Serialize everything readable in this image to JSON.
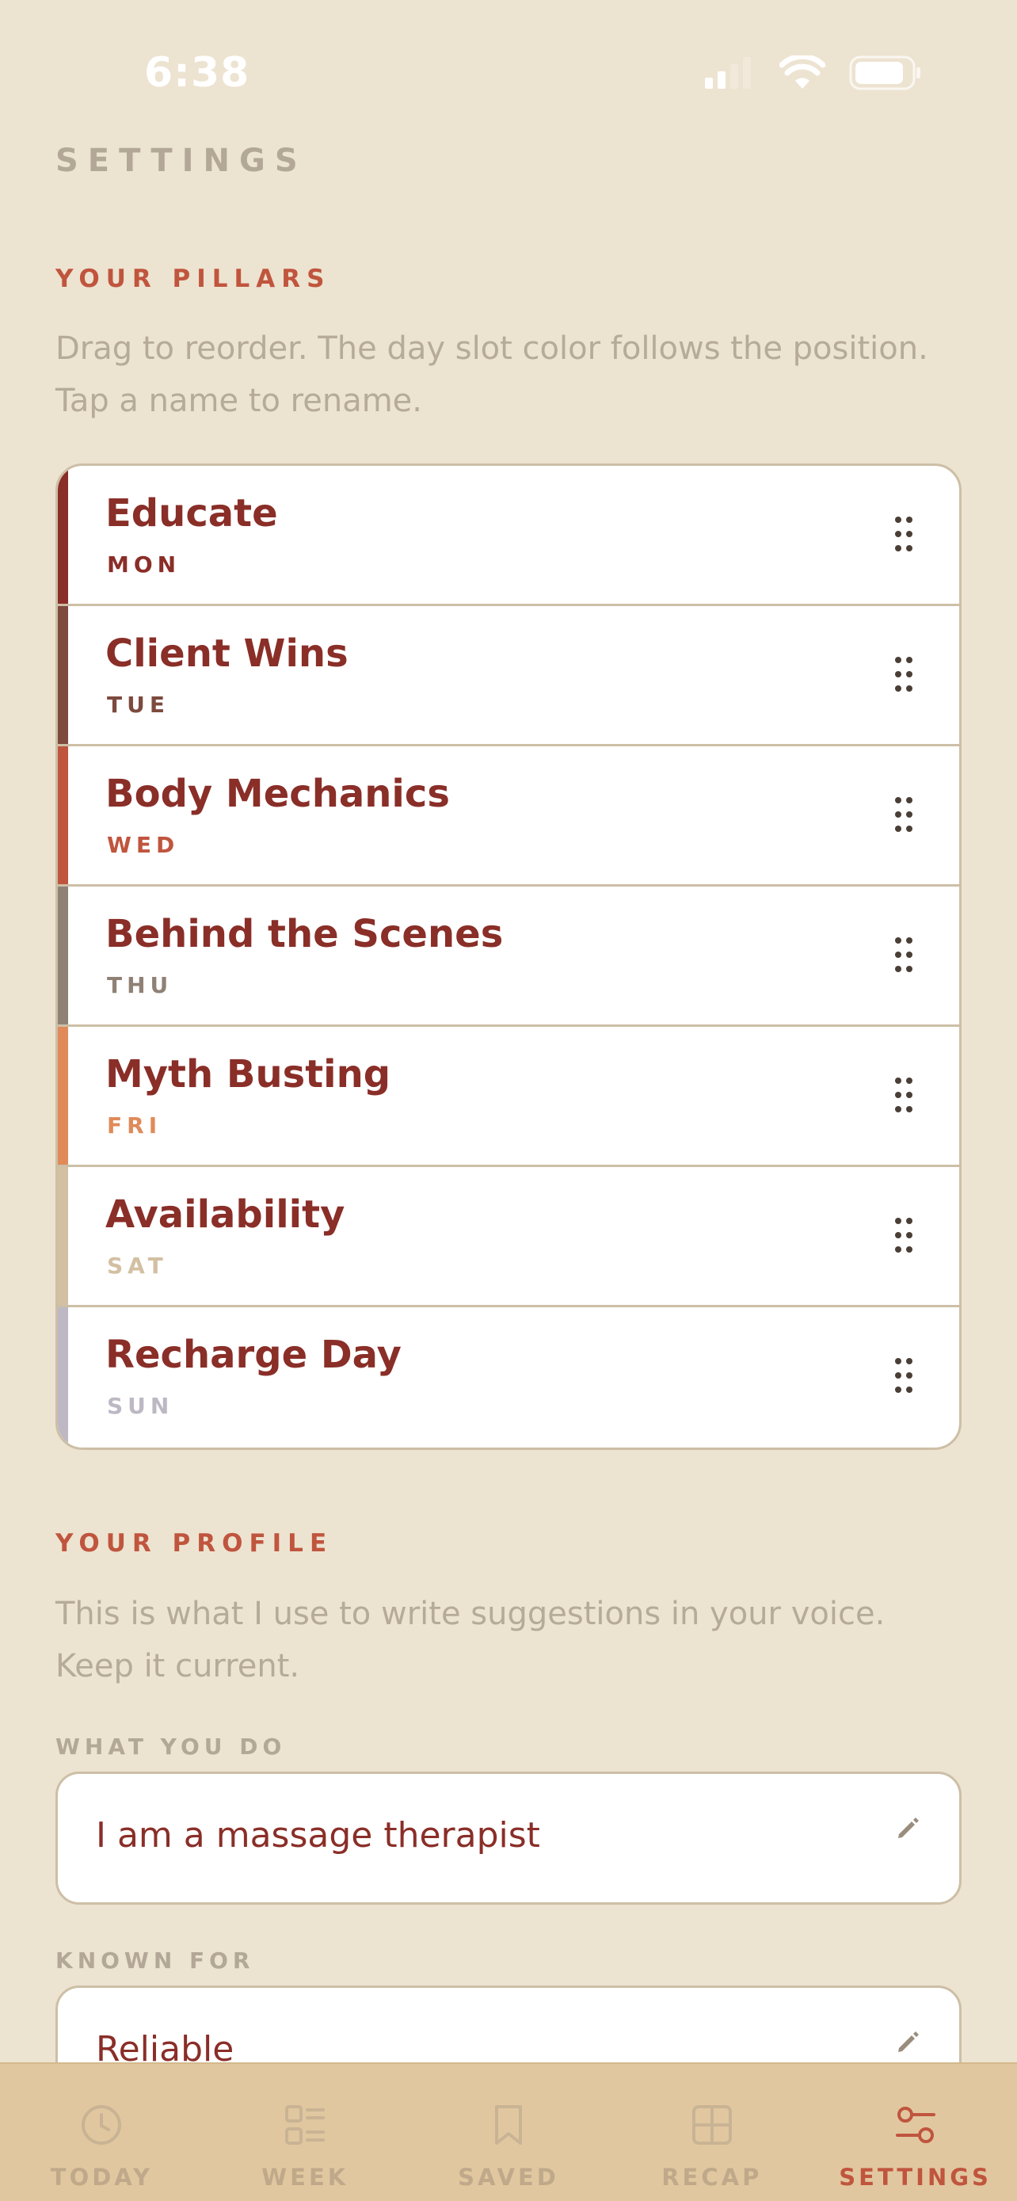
{
  "status": {
    "time": "6:38"
  },
  "page": {
    "title": "SETTINGS"
  },
  "pillars": {
    "label": "YOUR PILLARS",
    "description": "Drag to reorder. The day slot color follows the position. Tap a name to rename.",
    "items": [
      {
        "name": "Educate",
        "day": "MON",
        "color": "#8a2e28"
      },
      {
        "name": "Client Wins",
        "day": "TUE",
        "color": "#7d4a3e"
      },
      {
        "name": "Body Mechanics",
        "day": "WED",
        "color": "#c0553e"
      },
      {
        "name": "Behind the Scenes",
        "day": "THU",
        "color": "#8f8275"
      },
      {
        "name": "Myth Busting",
        "day": "FRI",
        "color": "#e08a5a"
      },
      {
        "name": "Availability",
        "day": "SAT",
        "color": "#d3c0a2"
      },
      {
        "name": "Recharge Day",
        "day": "SUN",
        "color": "#bdb8c4"
      }
    ]
  },
  "profile": {
    "label": "YOUR PROFILE",
    "description": "This is what I use to write suggestions in your voice. Keep it current.",
    "fields": [
      {
        "label": "WHAT YOU DO",
        "value": "I am a massage therapist"
      },
      {
        "label": "KNOWN FOR",
        "value": "Reliable"
      }
    ]
  },
  "tabs": [
    {
      "label": "TODAY",
      "icon": "clock-icon"
    },
    {
      "label": "WEEK",
      "icon": "list-grid-icon"
    },
    {
      "label": "SAVED",
      "icon": "bookmark-icon"
    },
    {
      "label": "RECAP",
      "icon": "grid-icon"
    },
    {
      "label": "SETTINGS",
      "icon": "sliders-icon",
      "active": true
    }
  ],
  "colors": {
    "background": "#ede3d1",
    "accent": "#c0553e",
    "text_primary": "#8a2e28",
    "text_muted": "#b3a897",
    "tab_bar": "#e1c79f"
  }
}
